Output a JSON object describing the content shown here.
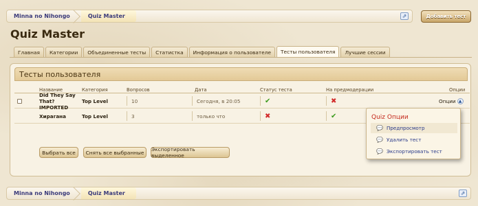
{
  "breadcrumb": {
    "items": [
      "Minna no Nihongo",
      "Quiz Master"
    ]
  },
  "header": {
    "add_test_label": "Добавить тест",
    "jump_icon": "⇗"
  },
  "page_title": "Quiz Master",
  "tabs": [
    {
      "label": "Главная"
    },
    {
      "label": "Категории"
    },
    {
      "label": "Объединенные тесты"
    },
    {
      "label": "Статистка"
    },
    {
      "label": "Информация о пользователе"
    },
    {
      "label": "Тесты пользователя",
      "active": true
    },
    {
      "label": "Лучшие сессии"
    }
  ],
  "panel": {
    "title": "Тесты пользователя",
    "columns": {
      "name": "Название",
      "category": "Категория",
      "questions": "Вопросов",
      "date": "Дата",
      "status": "Статус теста",
      "moderation": "На предмодерации",
      "options": "Опции"
    },
    "rows": [
      {
        "name": "Did They Say That? IMPORTED",
        "category": "Top Level",
        "questions": "10",
        "date": "Сегодня, в 20:05",
        "status": "ok",
        "moderation": "x",
        "options": "Опции",
        "checkbox": true
      },
      {
        "name": "Хирагана",
        "category": "Top Level",
        "questions": "3",
        "date": "только что",
        "status": "x",
        "moderation": "ok",
        "options": "",
        "checkbox": false
      }
    ],
    "actions": {
      "select_all": "Выбрать все",
      "deselect_all": "Снять все выбранные",
      "export_selected": "Экспортировать выделенное"
    }
  },
  "options_menu": {
    "title": "Quiz Опции",
    "items": [
      "Предпросмотр",
      "Удалить тест",
      "Экспортировать тест"
    ]
  },
  "status_icons": {
    "ok": "✔",
    "x": "✖"
  },
  "colors": {
    "accent": "#c4281c",
    "link": "#3a3a7a",
    "ok": "#3b9a1d",
    "error": "#d22a2a"
  }
}
